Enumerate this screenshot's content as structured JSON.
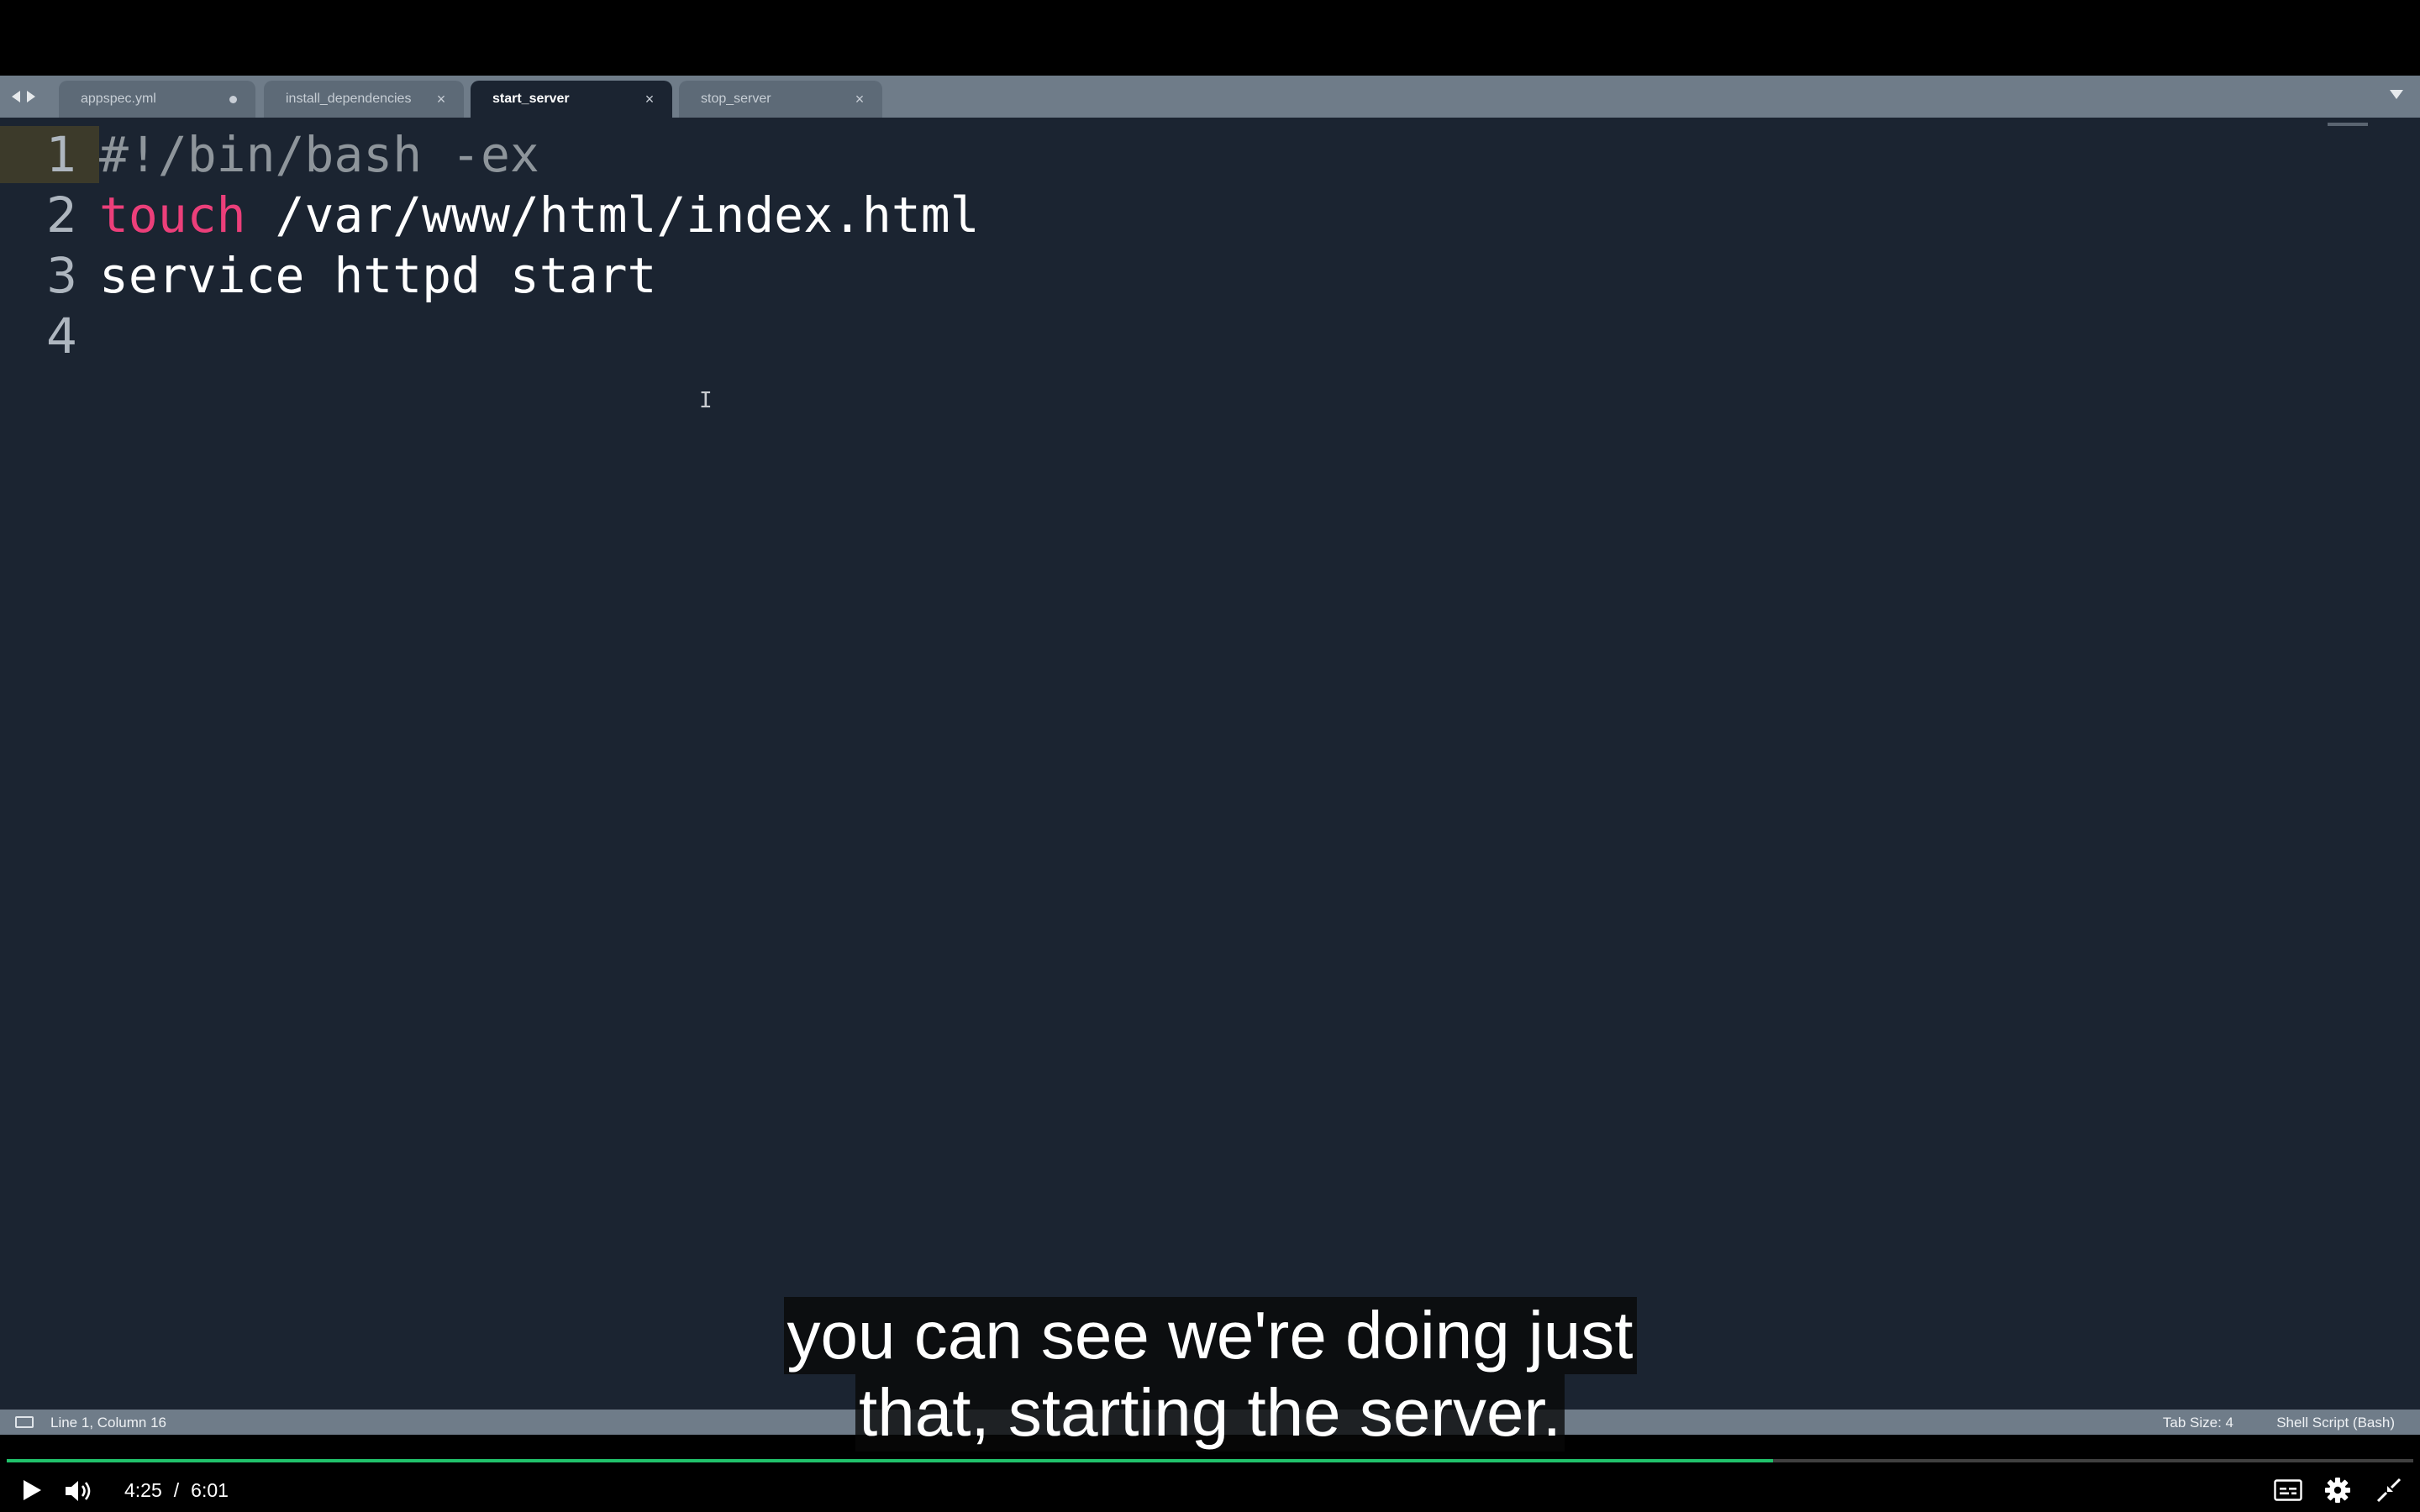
{
  "tabs": [
    {
      "label": "appspec.yml",
      "active": false,
      "indicator": "dirty-dot"
    },
    {
      "label": "install_dependencies",
      "active": false,
      "indicator": "close"
    },
    {
      "label": "start_server",
      "active": true,
      "indicator": "close"
    },
    {
      "label": "stop_server",
      "active": false,
      "indicator": "close"
    }
  ],
  "tab_close_glyph": "×",
  "editor": {
    "lines": [
      {
        "number": "1",
        "tokens": [
          {
            "text": "#!/bin/bash -ex",
            "kind": "comment"
          }
        ]
      },
      {
        "number": "2",
        "tokens": [
          {
            "text": "touch",
            "kind": "keyword"
          },
          {
            "text": " /var/www/html/index.html",
            "kind": "plain"
          }
        ]
      },
      {
        "number": "3",
        "tokens": [
          {
            "text": "service httpd start",
            "kind": "plain"
          }
        ]
      },
      {
        "number": "4",
        "tokens": []
      }
    ],
    "colors": {
      "background": "#1b2431",
      "keyword": "#ec3f7a",
      "comment": "#8e959b",
      "plain": "#ffffff"
    }
  },
  "statusbar": {
    "position": "Line 1, Column 16",
    "tab_size": "Tab Size: 4",
    "syntax": "Shell Script (Bash)"
  },
  "subtitles": {
    "line1": "you can see we're doing just",
    "line2": "that, starting the server."
  },
  "player": {
    "current_time": "4:25",
    "separator": "/",
    "duration": "6:01",
    "progress_fraction": 0.734,
    "accent_color": "#21c26b"
  },
  "icons": {
    "back": "chevron-left-icon",
    "forward": "chevron-right-icon",
    "tab_menu": "chevron-down-icon",
    "play": "play-icon",
    "volume": "volume-icon",
    "captions": "captions-icon",
    "settings": "gear-icon",
    "fullscreen": "exit-fullscreen-icon"
  }
}
